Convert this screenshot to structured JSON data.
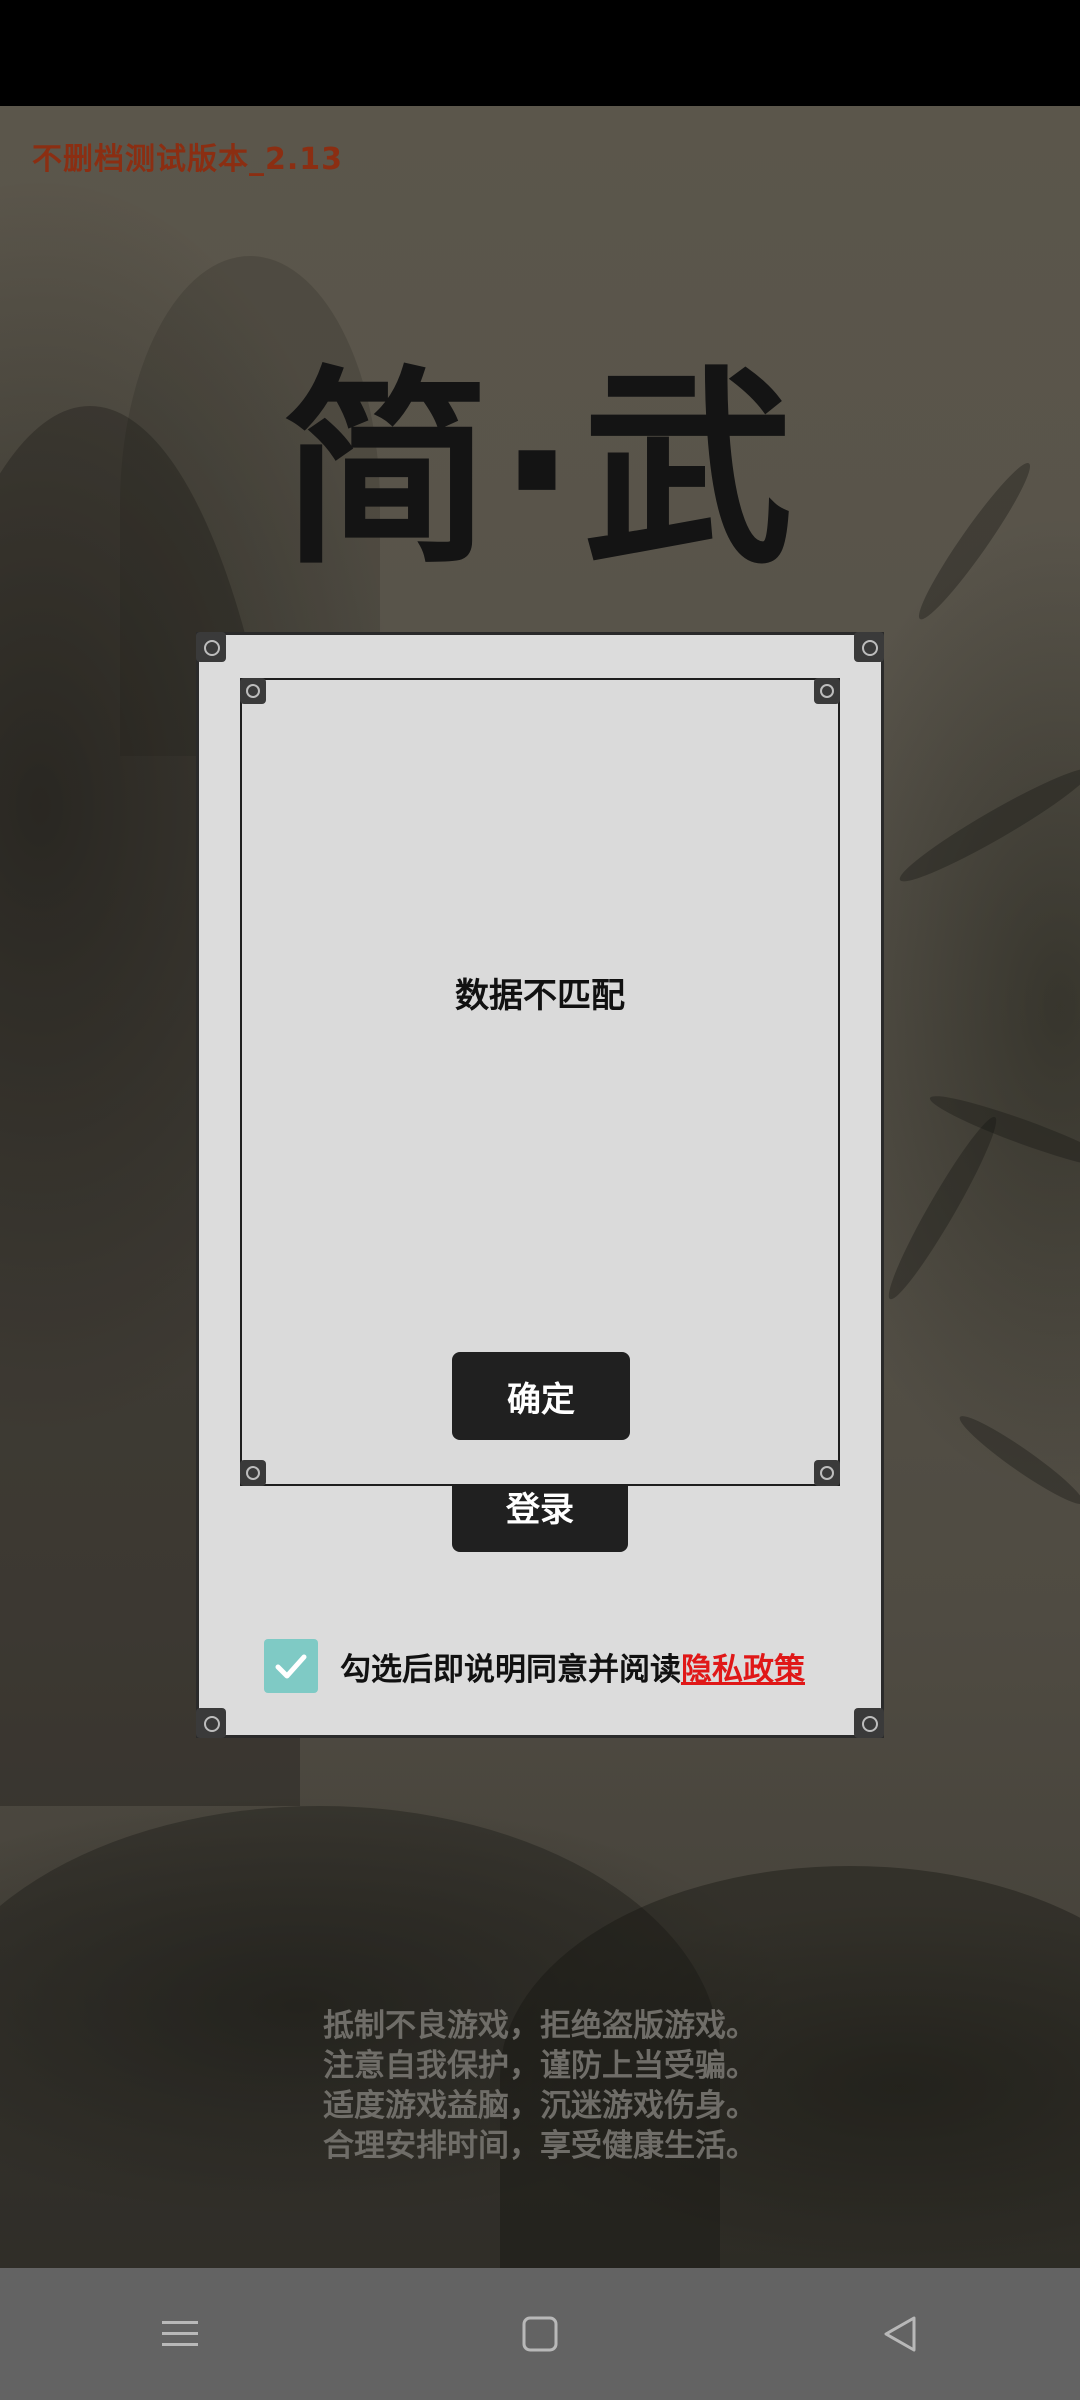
{
  "version_label": "不删档测试版本_2.13",
  "game_title": "简·武",
  "login": {
    "button_label": "登录",
    "agree_text": "勾选后即说明同意并阅读",
    "privacy_link": "隐私政策",
    "checkbox_checked": true
  },
  "dialog": {
    "message": "数据不匹配",
    "confirm_label": "确定"
  },
  "health_notice": [
    "抵制不良游戏，拒绝盗版游戏。",
    "注意自我保护，谨防上当受骗。",
    "适度游戏益脑，沉迷游戏伤身。",
    "合理安排时间，享受健康生活。"
  ],
  "nav_bar": {
    "icons": [
      "menu-icon",
      "home-icon",
      "back-icon"
    ]
  },
  "colors": {
    "version_text": "#8b2e12",
    "privacy_link": "#e01818",
    "checkbox": "#7fcac5",
    "button_bg": "#202020"
  }
}
